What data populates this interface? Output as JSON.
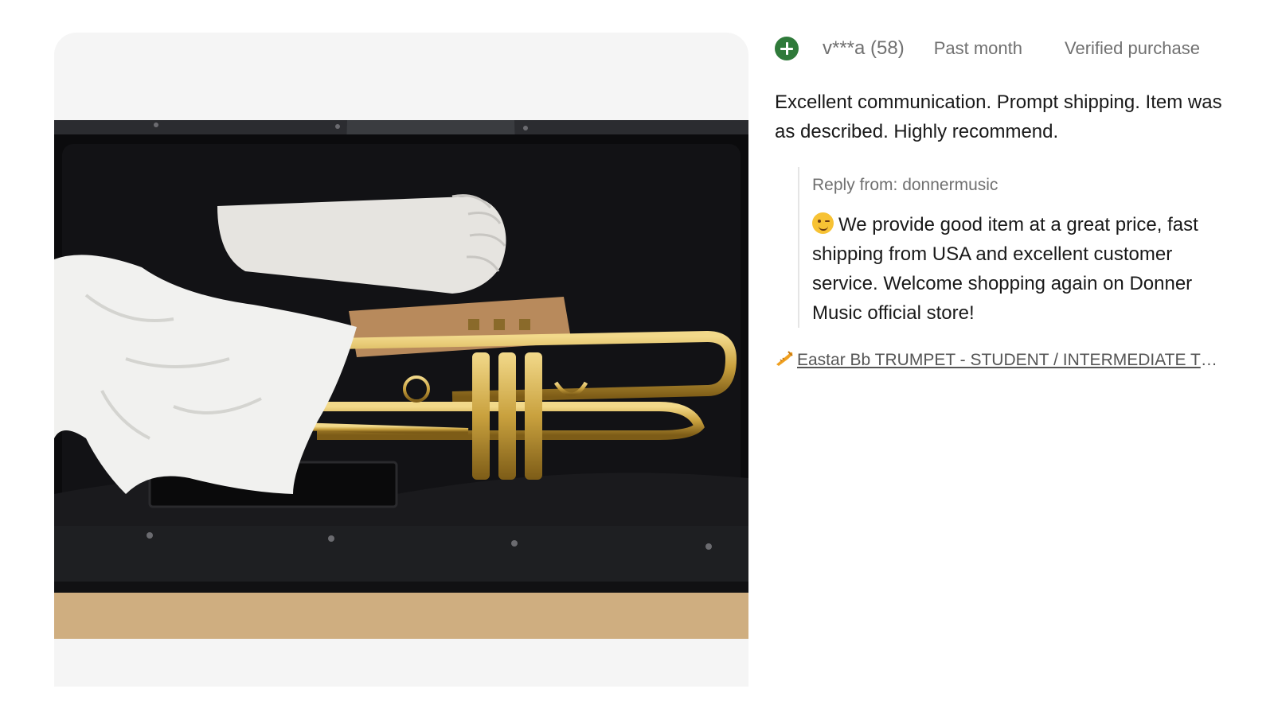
{
  "review": {
    "rating_icon": "positive-plus-icon",
    "rating_color": "#2f7a3a",
    "username": "v***a (58)",
    "time": "Past month",
    "verified": "Verified purchase",
    "text": "Excellent communication. Prompt shipping. Item was as described. Highly recommend.",
    "reply": {
      "from": "Reply from: donnermusic",
      "emoji": "winking-face-emoji",
      "text": "We provide good item at a great price, fast shipping from USA and excellent customer service. Welcome shopping again on Donner Music official store!"
    },
    "item_link": {
      "icon": "trumpet-icon",
      "label": "Eastar Bb TRUMPET - STUDENT / INTERMEDIATE TRUMPET WITH CASE"
    }
  },
  "photo": {
    "subject": "trumpet-in-case-photo"
  }
}
